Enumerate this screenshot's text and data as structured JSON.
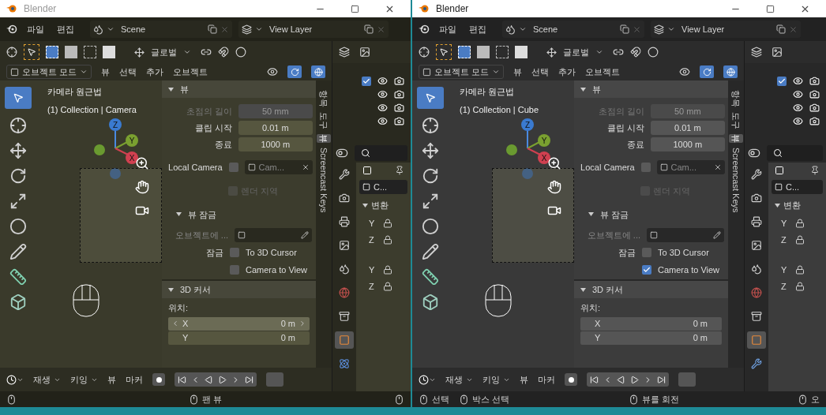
{
  "windows": [
    {
      "title": "Blender",
      "menus": [
        "파일",
        "편집"
      ],
      "scene": "Scene",
      "view_layer": "View Layer",
      "orientation": "글로벌",
      "mode": "오브젝트 모드",
      "view_menus": [
        "뷰",
        "선택",
        "추가",
        "오브젝트"
      ],
      "viewport": {
        "title": "카메라 원근법",
        "subtitle": "(1) Collection | Camera",
        "axes": [
          "Z",
          "Y",
          "X"
        ]
      },
      "sidebar": {
        "tabs": [
          {
            "label": "항목",
            "selected": false
          },
          {
            "label": "도구",
            "selected": false
          },
          {
            "label": "뷰",
            "selected": true
          },
          {
            "label": "Screencast Keys",
            "selected": false
          }
        ],
        "view_panel": {
          "title": "뷰",
          "expanded": true,
          "rows": [
            {
              "label": "초점의 길이",
              "value": "50 mm",
              "disabled": true
            },
            {
              "label": "클립 시작",
              "value": "0.01 m",
              "disabled": false
            },
            {
              "label": "종료",
              "value": "1000 m",
              "disabled": false
            }
          ],
          "local_camera": {
            "label": "Local Camera",
            "checked": false,
            "value": "Cam..."
          },
          "render_region": {
            "label": "렌더 지역",
            "checked": false,
            "disabled": true
          },
          "lock": {
            "title": "뷰 잠금",
            "expanded": true,
            "object_label": "오브젝트에 ...",
            "lock_label": "잠금",
            "options": [
              {
                "label": "To 3D Cursor",
                "checked": false
              },
              {
                "label": "Camera to View",
                "checked": false
              }
            ]
          }
        },
        "cursor_panel": {
          "title": "3D 커서",
          "expanded": true,
          "location_label": "위치:",
          "rows": [
            {
              "axis": "X",
              "value": "0 m",
              "highlighted": true
            },
            {
              "axis": "Y",
              "value": "0 m",
              "highlighted": false
            }
          ]
        }
      },
      "outliner": {
        "rows": [
          {
            "kind": "checkbox",
            "checked": true
          },
          {
            "kind": "plain"
          },
          {
            "kind": "plain"
          },
          {
            "kind": "plain"
          }
        ]
      },
      "properties": {
        "tabs": [
          {
            "kind": "tool",
            "selected": false
          },
          {
            "kind": "render",
            "selected": false
          },
          {
            "kind": "output",
            "selected": false
          },
          {
            "kind": "view_layer",
            "selected": false
          },
          {
            "kind": "scene",
            "selected": false
          },
          {
            "kind": "world",
            "selected": false
          },
          {
            "kind": "collection",
            "selected": false
          },
          {
            "kind": "object",
            "selected": true
          },
          {
            "kind": "physics",
            "selected": false
          }
        ],
        "object_name": "C...",
        "section": "변환",
        "section_expanded": true,
        "axes": [
          "Y",
          "Z",
          "Y",
          "Z"
        ]
      },
      "timeline": {
        "menus": [
          "재생",
          "키잉"
        ],
        "items": [
          "뷰",
          "마커"
        ]
      },
      "status": {
        "left": [
          {
            "kind": "mouse"
          }
        ],
        "center": [
          {
            "kind": "mouse",
            "text": "팬 뷰"
          }
        ],
        "right": [
          {
            "kind": "mouse"
          }
        ]
      }
    },
    {
      "title": "Blender",
      "menus": [
        "파일",
        "편집"
      ],
      "scene": "Scene",
      "view_layer": "View Layer",
      "orientation": "글로벌",
      "mode": "오브젝트 모드",
      "view_menus": [
        "뷰",
        "선택",
        "추가",
        "오브젝트"
      ],
      "viewport": {
        "title": "카메라 원근법",
        "subtitle": "(1) Collection | Cube",
        "axes": [
          "Z",
          "Y",
          "X"
        ]
      },
      "sidebar": {
        "tabs": [
          {
            "label": "항목",
            "selected": false
          },
          {
            "label": "도구",
            "selected": false
          },
          {
            "label": "뷰",
            "selected": true
          },
          {
            "label": "Screencast Keys",
            "selected": false
          }
        ],
        "view_panel": {
          "title": "뷰",
          "expanded": true,
          "rows": [
            {
              "label": "초점의 길이",
              "value": "50 mm",
              "disabled": true
            },
            {
              "label": "클립 시작",
              "value": "0.01 m",
              "disabled": false
            },
            {
              "label": "종료",
              "value": "1000 m",
              "disabled": false
            }
          ],
          "local_camera": {
            "label": "Local Camera",
            "checked": false,
            "value": "Cam..."
          },
          "render_region": {
            "label": "렌더 지역",
            "checked": false,
            "disabled": true
          },
          "lock": {
            "title": "뷰 잠금",
            "expanded": true,
            "object_label": "오브젝트에 ...",
            "lock_label": "잠금",
            "options": [
              {
                "label": "To 3D Cursor",
                "checked": false
              },
              {
                "label": "Camera to View",
                "checked": true
              }
            ]
          }
        },
        "cursor_panel": {
          "title": "3D 커서",
          "expanded": true,
          "location_label": "위치:",
          "rows": [
            {
              "axis": "X",
              "value": "0 m",
              "highlighted": false
            },
            {
              "axis": "Y",
              "value": "0 m",
              "highlighted": false
            }
          ]
        }
      },
      "outliner": {
        "rows": [
          {
            "kind": "checkbox",
            "checked": true
          },
          {
            "kind": "plain"
          },
          {
            "kind": "plain"
          },
          {
            "kind": "plain"
          }
        ]
      },
      "properties": {
        "tabs": [
          {
            "kind": "tool",
            "selected": false
          },
          {
            "kind": "render",
            "selected": false
          },
          {
            "kind": "output",
            "selected": false
          },
          {
            "kind": "view_layer",
            "selected": false
          },
          {
            "kind": "scene",
            "selected": false
          },
          {
            "kind": "world",
            "selected": false
          },
          {
            "kind": "collection",
            "selected": false
          },
          {
            "kind": "object",
            "selected": true
          },
          {
            "kind": "modifier",
            "selected": false
          }
        ],
        "object_name": "C...",
        "section": "변환",
        "section_expanded": true,
        "axes": [
          "Y",
          "Z",
          "Y",
          "Z"
        ]
      },
      "timeline": {
        "menus": [
          "재생",
          "키잉"
        ],
        "items": [
          "뷰",
          "마커"
        ]
      },
      "status": {
        "left": [
          {
            "kind": "mouse",
            "text": "선택"
          },
          {
            "kind": "mouse",
            "text": "박스 선택"
          }
        ],
        "center": [
          {
            "kind": "mouse",
            "text": "뷰를 회전"
          }
        ],
        "right": [
          {
            "kind": "mouse",
            "text": "오"
          }
        ]
      }
    }
  ]
}
